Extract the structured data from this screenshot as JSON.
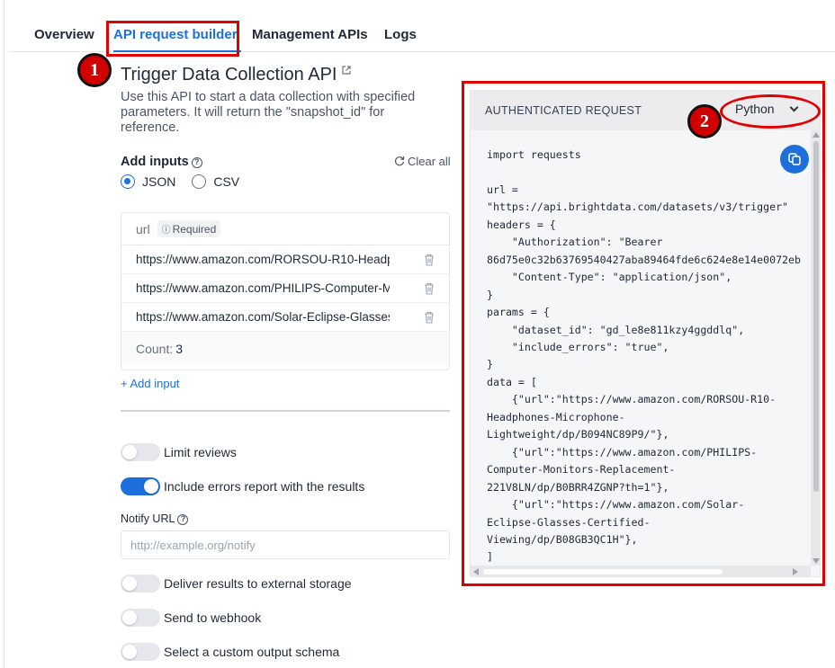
{
  "tabs": [
    {
      "label": "Overview",
      "active": false
    },
    {
      "label": "API request builder",
      "active": true
    },
    {
      "label": "Management APIs",
      "active": false
    },
    {
      "label": "Logs",
      "active": false
    }
  ],
  "annotations": {
    "badge_1": "1",
    "badge_2": "2",
    "color": "#e00000"
  },
  "api": {
    "title": "Trigger Data Collection API",
    "description": "Use this API to start a data collection with specified parameters. It will return the \"snapshot_id\" for reference.",
    "title_icon": "external-link-icon"
  },
  "inputs": {
    "heading": "Add inputs",
    "clear_label": "Clear all",
    "formats": [
      {
        "label": "JSON",
        "selected": true
      },
      {
        "label": "CSV",
        "selected": false
      }
    ],
    "column_label": "url",
    "required_label": "Required",
    "rows": [
      "https://www.amazon.com/RORSOU-R10-Headphones-Microphone-Lightweight/dp/B094NC89P9/",
      "https://www.amazon.com/PHILIPS-Computer-Monitors-Replacement-221V8LN/dp/B0BRR4ZGNP?th=1",
      "https://www.amazon.com/Solar-Eclipse-Glasses-Certified-Viewing/dp/B08GB3QC1H"
    ],
    "count_label": "Count:",
    "count_value": "3",
    "add_label": "+ Add input"
  },
  "options": {
    "limit_reviews": {
      "label": "Limit reviews",
      "on": false
    },
    "include_errors": {
      "label": "Include errors report with the results",
      "on": true
    },
    "notify_label": "Notify URL",
    "notify_placeholder": "http://example.org/notify",
    "external_storage": {
      "label": "Deliver results to external storage",
      "on": false
    },
    "webhook": {
      "label": "Send to webhook",
      "on": false
    },
    "custom_schema": {
      "label": "Select a custom output schema",
      "on": false
    }
  },
  "code_panel": {
    "header": "AUTHENTICATED REQUEST",
    "language": "Python",
    "code": "import requests\n\nurl =\n\"https://api.brightdata.com/datasets/v3/trigger\"\nheaders = {\n    \"Authorization\": \"Bearer\n86d75e0c32b63769540427aba89464fde6c624e8e14e0072eb\n    \"Content-Type\": \"application/json\",\n}\nparams = {\n    \"dataset_id\": \"gd_le8e811kzy4ggddlq\",\n    \"include_errors\": \"true\",\n}\ndata = [\n    {\"url\":\"https://www.amazon.com/RORSOU-R10-\nHeadphones-Microphone-\nLightweight/dp/B094NC89P9/\"},\n    {\"url\":\"https://www.amazon.com/PHILIPS-\nComputer-Monitors-Replacement-\n221V8LN/dp/B0BRR4ZGNP?th=1\"},\n    {\"url\":\"https://www.amazon.com/Solar-\nEclipse-Glasses-Certified-\nViewing/dp/B08GB3QC1H\"},\n]"
  },
  "colors": {
    "accent": "#1d6fdc",
    "annotation": "#e00000",
    "panel_bg": "#f5f6f7"
  }
}
